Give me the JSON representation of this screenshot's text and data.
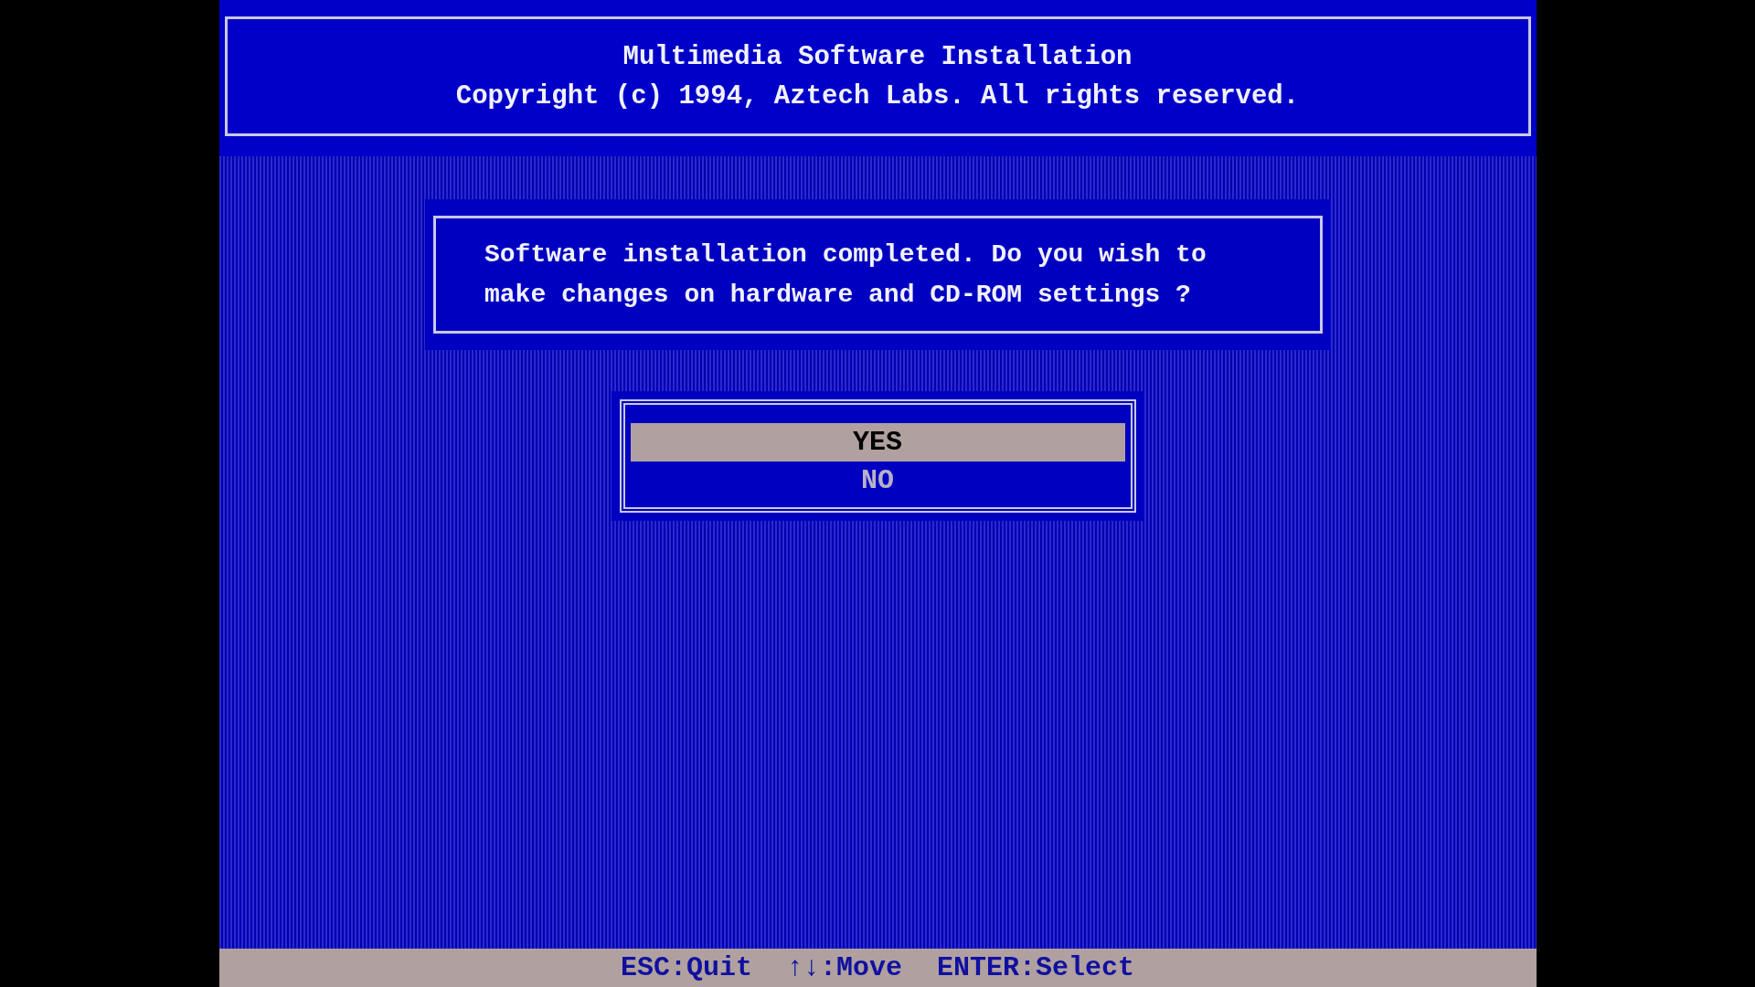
{
  "header": {
    "title": "Multimedia Software Installation",
    "copyright": "Copyright (c) 1994, Aztech Labs. All rights reserved."
  },
  "message": "Software installation completed. Do you wish to make changes on hardware and CD-ROM settings ?",
  "menu": [
    {
      "label": "YES",
      "selected": true
    },
    {
      "label": "NO",
      "selected": false
    }
  ],
  "status_bar": [
    "ESC:Quit",
    "↑↓:Move",
    "ENTER:Select"
  ]
}
